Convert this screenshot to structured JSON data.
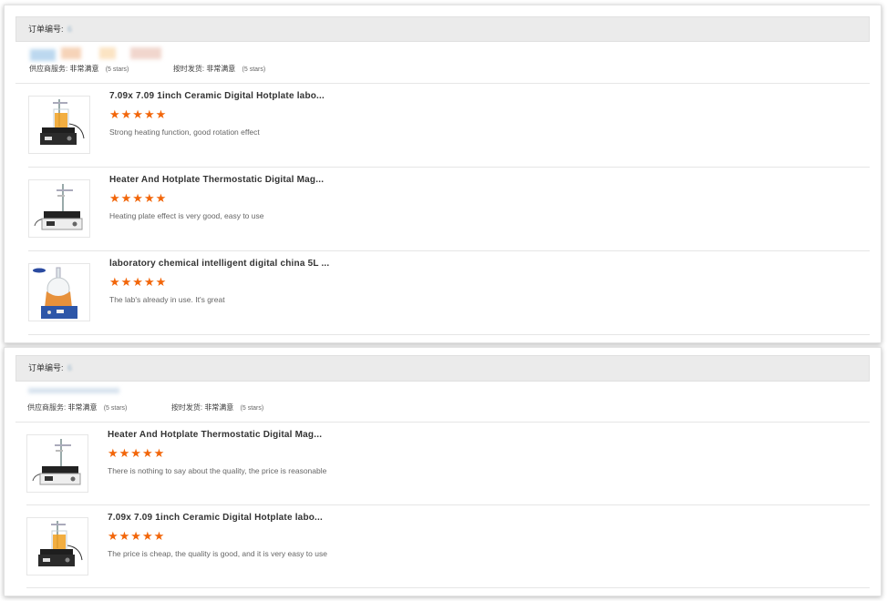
{
  "orders": [
    {
      "header_label": "订单编号:",
      "order_number": "6",
      "service_label": "供应商服务:",
      "service_value": "非常满意",
      "service_stars": "(5 stars)",
      "shipping_label": "按时发货:",
      "shipping_value": "非常满意",
      "shipping_stars": "(5 stars)",
      "items": [
        {
          "title": "7.09x 7.09 1inch Ceramic Digital Hotplate labo...",
          "rating": "★★★★★",
          "review": "Strong heating function, good rotation effect",
          "icon": "hotplate-stirrer-beaker-icon"
        },
        {
          "title": "Heater And Hotplate Thermostatic Digital Mag...",
          "rating": "★★★★★",
          "review": "Heating plate effect is very good, easy to use",
          "icon": "hotplate-stirrer-icon"
        },
        {
          "title": "laboratory chemical intelligent digital china 5L ...",
          "rating": "★★★★★",
          "review": "The lab's already in use. It's great",
          "icon": "heating-mantle-flask-icon"
        }
      ]
    },
    {
      "header_label": "订单编号:",
      "order_number": "6",
      "service_label": "供应商服务:",
      "service_value": "非常满意",
      "service_stars": "(5 stars)",
      "shipping_label": "按时发货:",
      "shipping_value": "非常满意",
      "shipping_stars": "(5 stars)",
      "items": [
        {
          "title": "Heater And Hotplate Thermostatic Digital Mag...",
          "rating": "★★★★★",
          "review": "There is nothing to say about the quality, the price is reasonable",
          "icon": "hotplate-stirrer-icon"
        },
        {
          "title": "7.09x 7.09 1inch Ceramic Digital Hotplate labo...",
          "rating": "★★★★★",
          "review": "The price is cheap, the quality is good, and it is very easy to use",
          "icon": "hotplate-stirrer-beaker-icon"
        }
      ]
    }
  ],
  "colors": {
    "star": "#f2660a",
    "header_bg": "#ebebeb",
    "divider": "#e6e6e6"
  }
}
